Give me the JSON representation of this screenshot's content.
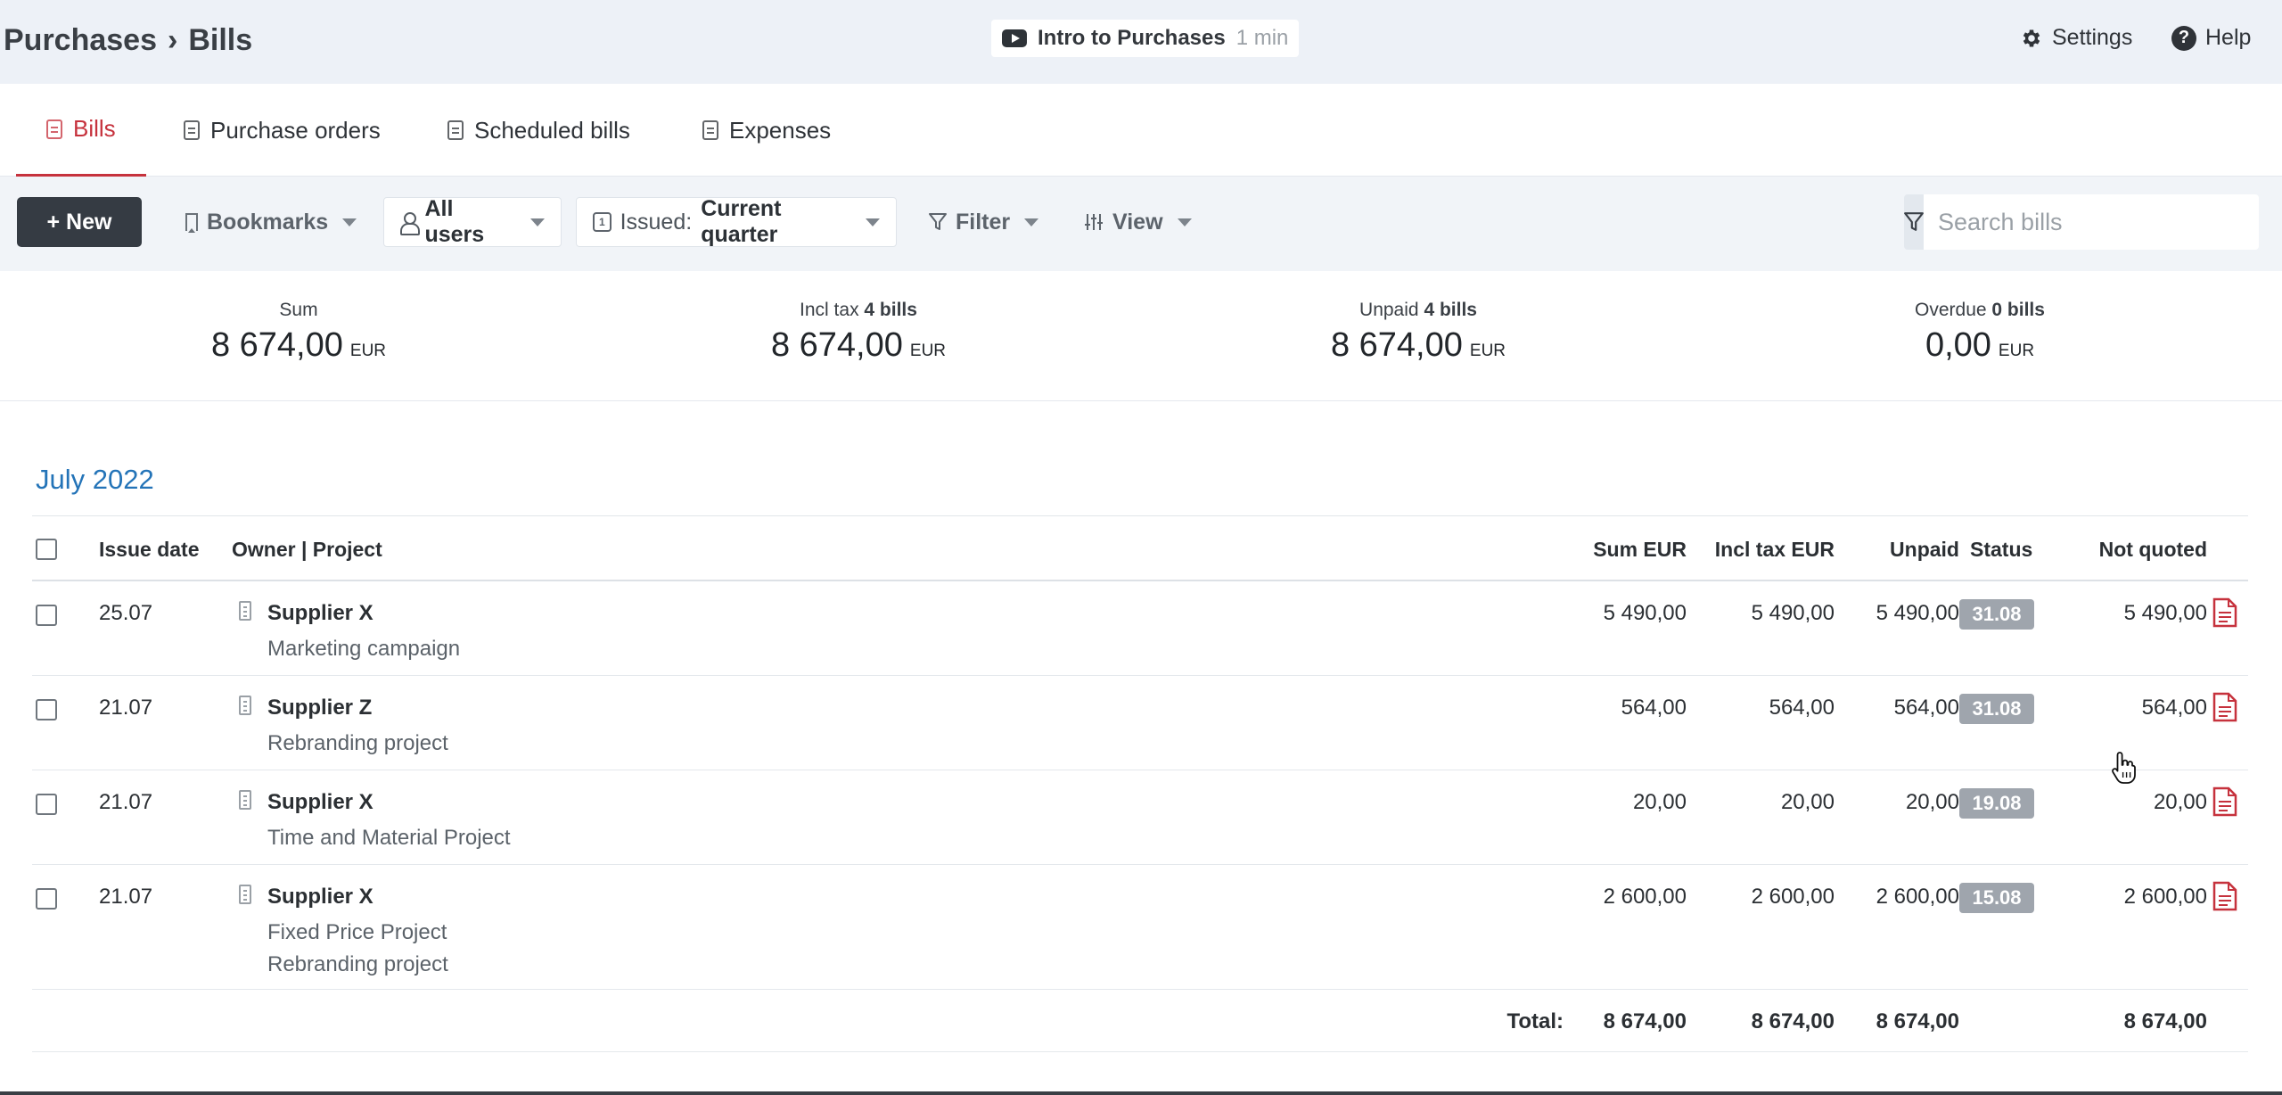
{
  "header": {
    "breadcrumb_parent": "Purchases",
    "breadcrumb_sep": "›",
    "breadcrumb_current": "Bills",
    "intro_title": "Intro to Purchases",
    "intro_duration": "1 min",
    "settings_label": "Settings",
    "help_label": "Help",
    "help_glyph": "?"
  },
  "tabs": [
    {
      "label": "Bills",
      "active": true
    },
    {
      "label": "Purchase orders",
      "active": false
    },
    {
      "label": "Scheduled bills",
      "active": false
    },
    {
      "label": "Expenses",
      "active": false
    }
  ],
  "toolbar": {
    "new_label": "+ New",
    "bookmarks_label": "Bookmarks",
    "users_label": "All users",
    "calendar_glyph": "1",
    "issued_label": "Issued:",
    "issued_value": "Current quarter",
    "filter_label": "Filter",
    "view_label": "View",
    "search_placeholder": "Search bills"
  },
  "summary": [
    {
      "label": "Sum",
      "count": "",
      "value": "8 674,00",
      "currency": "EUR"
    },
    {
      "label": "Incl tax",
      "count": "4 bills",
      "value": "8 674,00",
      "currency": "EUR"
    },
    {
      "label": "Unpaid",
      "count": "4 bills",
      "value": "8 674,00",
      "currency": "EUR"
    },
    {
      "label": "Overdue",
      "count": "0 bills",
      "value": "0,00",
      "currency": "EUR"
    }
  ],
  "table": {
    "month": "July 2022",
    "columns": {
      "issue_date": "Issue date",
      "owner_project": "Owner | Project",
      "sum": "Sum EUR",
      "incl_tax": "Incl tax EUR",
      "unpaid": "Unpaid",
      "status": "Status",
      "not_quoted": "Not quoted"
    },
    "rows": [
      {
        "date": "25.07",
        "supplier": "Supplier X",
        "projects": [
          "Marketing campaign"
        ],
        "sum": "5 490,00",
        "incl_tax": "5 490,00",
        "unpaid": "5 490,00",
        "status": "31.08",
        "not_quoted": "5 490,00"
      },
      {
        "date": "21.07",
        "supplier": "Supplier Z",
        "projects": [
          "Rebranding project"
        ],
        "sum": "564,00",
        "incl_tax": "564,00",
        "unpaid": "564,00",
        "status": "31.08",
        "not_quoted": "564,00"
      },
      {
        "date": "21.07",
        "supplier": "Supplier X",
        "projects": [
          "Time and Material Project"
        ],
        "sum": "20,00",
        "incl_tax": "20,00",
        "unpaid": "20,00",
        "status": "19.08",
        "not_quoted": "20,00"
      },
      {
        "date": "21.07",
        "supplier": "Supplier X",
        "projects": [
          "Fixed Price Project",
          "Rebranding project"
        ],
        "sum": "2 600,00",
        "incl_tax": "2 600,00",
        "unpaid": "2 600,00",
        "status": "15.08",
        "not_quoted": "2 600,00"
      }
    ],
    "total": {
      "label": "Total:",
      "sum": "8 674,00",
      "incl_tax": "8 674,00",
      "unpaid": "8 674,00",
      "not_quoted": "8 674,00"
    }
  },
  "colors": {
    "accent_red": "#c6323d",
    "link_blue": "#2474b8",
    "dark_button": "#353b43",
    "status_gray": "#9fa5ad"
  },
  "icons": [
    "youtube-icon",
    "gear-icon",
    "help-icon",
    "bill-icon",
    "bookmark-icon",
    "user-icon",
    "calendar-icon",
    "funnel-icon",
    "sliders-icon",
    "project-icon",
    "pdf-icon",
    "hand-cursor-icon"
  ]
}
